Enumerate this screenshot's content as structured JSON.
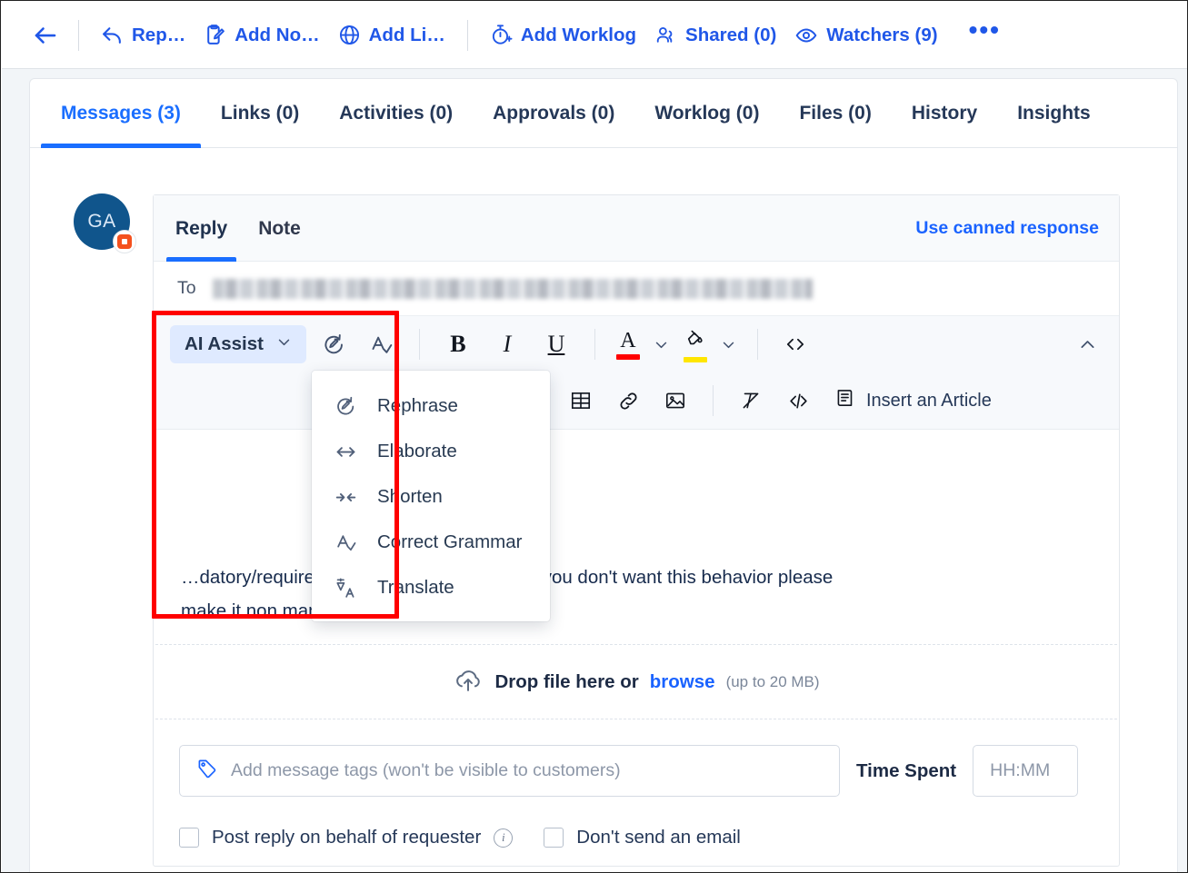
{
  "topbar": {
    "back_label": "back",
    "actions": [
      {
        "label": "Rep…",
        "icon": "reply-icon"
      },
      {
        "label": "Add No…",
        "icon": "add-note-icon"
      },
      {
        "label": "Add Li…",
        "icon": "globe-icon"
      },
      {
        "label": "Add Worklog",
        "icon": "stopwatch-plus-icon"
      },
      {
        "label": "Shared (0)",
        "icon": "people-icon"
      },
      {
        "label": "Watchers (9)",
        "icon": "eye-icon"
      }
    ],
    "overflow_label": "•••"
  },
  "tabs": [
    {
      "label": "Messages (3)",
      "active": true
    },
    {
      "label": "Links (0)",
      "active": false
    },
    {
      "label": "Activities (0)",
      "active": false
    },
    {
      "label": "Approvals (0)",
      "active": false
    },
    {
      "label": "Worklog (0)",
      "active": false
    },
    {
      "label": "Files (0)",
      "active": false
    },
    {
      "label": "History",
      "active": false
    },
    {
      "label": "Insights",
      "active": false
    }
  ],
  "avatar": {
    "initials": "GA",
    "badge_icon": "app-badge-icon"
  },
  "composer": {
    "tabs": [
      {
        "label": "Reply",
        "active": true
      },
      {
        "label": "Note",
        "active": false
      }
    ],
    "canned_response_label": "Use canned response",
    "to_label": "To",
    "to_value_redacted": "",
    "toolbar": {
      "ai_assist_label": "AI Assist",
      "rephrase_icon": "rephrase-icon",
      "grammar_icon": "correct-grammar-icon",
      "bold_label": "B",
      "italic_label": "I",
      "underline_label": "U",
      "font_color_glyph": "A",
      "font_color_hex": "#ff0000",
      "highlight_glyph": "fill-drop",
      "highlight_hex": "#ffe600",
      "code_label": "<>",
      "collapse_label": "^",
      "insert_article_label": "Insert an Article",
      "numbered_list_icon": "numbered-list-icon",
      "bullet_list_icon": "bullet-list-icon",
      "table_icon": "table-icon",
      "link_icon": "link-icon",
      "image_icon": "image-icon",
      "clear_format_icon": "clear-format-icon",
      "source_code_label": "</>"
    },
    "ai_menu": [
      {
        "label": "Rephrase",
        "icon": "rephrase-icon"
      },
      {
        "label": "Elaborate",
        "icon": "elaborate-icon"
      },
      {
        "label": "Shorten",
        "icon": "shorten-icon"
      },
      {
        "label": "Correct Grammar",
        "icon": "correct-grammar-icon"
      },
      {
        "label": "Translate",
        "icon": "translate-icon"
      }
    ],
    "message_text_line1": "…datory/required, user has to select Yes. If you don't want this behavior please",
    "message_text_line2": "make it non mandatory.",
    "dropzone": {
      "icon": "cloud-upload-icon",
      "text": "Drop file here or",
      "link": "browse",
      "hint": "(up to 20 MB)"
    },
    "tags": {
      "icon": "tag-icon",
      "placeholder": "Add message tags (won't be visible to customers)"
    },
    "time_spent": {
      "label": "Time Spent",
      "placeholder": "HH:MM"
    },
    "checkboxes": [
      {
        "label": "Post reply on behalf of requester",
        "has_info": true
      },
      {
        "label": "Don't send an email",
        "has_info": false
      }
    ]
  },
  "annotation": {
    "type": "highlight-rectangle",
    "color": "#ff0000"
  }
}
